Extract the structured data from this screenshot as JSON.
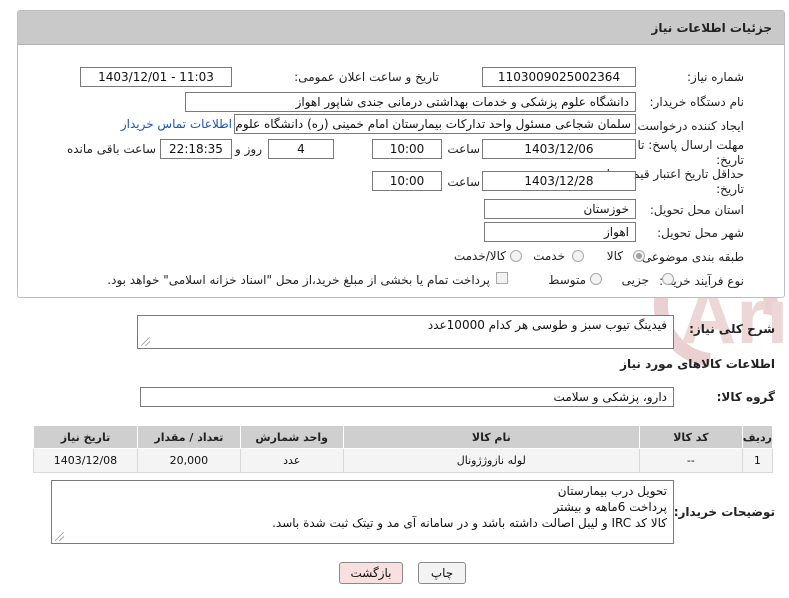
{
  "header": {
    "title": "جزئیات اطلاعات نیاز"
  },
  "fields": {
    "need_number_label": "شماره نیاز:",
    "need_number": "1103009025002364",
    "announce_label": "تاریخ و ساعت اعلان عمومی:",
    "announce_value": "1403/12/01 - 11:03",
    "buyer_org_label": "نام دستگاه خریدار:",
    "buyer_org": "دانشگاه علوم پزشکی و خدمات بهداشتی درمانی جندی شاپور اهواز",
    "creator_label": "ایجاد کننده درخواست:",
    "creator": "سلمان شجاعی مسئول واحد تدارکات بیمارستان امام خمینی (ره) دانشگاه علوم",
    "contact_link": "اطلاعات تماس خریدار",
    "deadline_label_1": "مهلت ارسال پاسخ: تا",
    "deadline_label_2": "تاریخ:",
    "deadline_date": "1403/12/06",
    "time_label": "ساعت",
    "deadline_time": "10:00",
    "days_value": "4",
    "days_label": "روز و",
    "remaining_time": "22:18:35",
    "remaining_label": "ساعت باقی مانده",
    "validity_label_1": "حداقل تاریخ اعتبار قیمت: تا",
    "validity_label_2": "تاریخ:",
    "validity_date": "1403/12/28",
    "validity_time": "10:00",
    "province_label": "استان محل تحویل:",
    "province": "خوزستان",
    "city_label": "شهر محل تحویل:",
    "city": "اهواز",
    "category_label": "طبقه بندی موضوعی:",
    "category_options": [
      "کالا",
      "خدمت",
      "کالا/خدمت"
    ],
    "process_label": "نوع فرآیند خرید :",
    "process_options": [
      "جزیی",
      "متوسط"
    ],
    "payment_note": "پرداخت تمام یا بخشی از مبلغ خرید،از محل \"اسناد خزانه اسلامی\" خواهد بود."
  },
  "description": {
    "label": "شرح کلی نیاز:",
    "value": "فیدینگ تیوب سبز و طوسی هر کدام 10000عدد"
  },
  "goods_section": {
    "title": "اطلاعات کالاهای مورد نیاز"
  },
  "goods_group": {
    "label": "گروه کالا:",
    "value": "دارو، پزشکی و سلامت"
  },
  "table": {
    "headers": [
      "ردیف",
      "کد کالا",
      "نام کالا",
      "واحد شمارش",
      "تعداد / مقدار",
      "تاریخ نیاز"
    ],
    "rows": [
      [
        "1",
        "--",
        "لوله نازوژژونال",
        "عدد",
        "20,000",
        "1403/12/08"
      ]
    ]
  },
  "buyer_notes": {
    "label": "توضیحات خریدار:",
    "lines": [
      "تحویل درب بیمارستان",
      "پرداخت 6ماهه و بیشتر",
      "کالا کد IRC و لیبل اصالت داشته باشد و در سامانه آی مد و تیتک ثبت شدة باسد."
    ]
  },
  "buttons": {
    "print": "چاپ",
    "back": "بازگشت"
  },
  "watermark": {
    "text": "AriaTender.net"
  },
  "colors": {
    "header_bg": "#c9c9c9",
    "link": "#1a53b4",
    "back_button_bg": "#f8e0e0",
    "watermark": "#e8c9c9"
  }
}
